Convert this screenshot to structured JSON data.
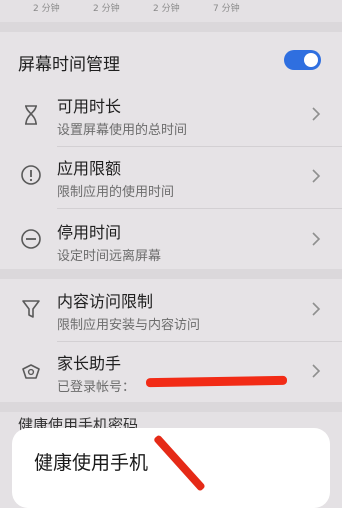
{
  "top_strip": {
    "labels": [
      "2 分钟",
      "2 分钟",
      "2 分钟",
      "7 分钟"
    ]
  },
  "screen_time": {
    "title": "屏幕时间管理",
    "toggle_on": true,
    "items": [
      {
        "icon": "hourglass-icon",
        "title": "可用时长",
        "subtitle": "设置屏幕使用的总时间"
      },
      {
        "icon": "exclamation-circle-icon",
        "title": "应用限额",
        "subtitle": "限制应用的使用时间"
      },
      {
        "icon": "minus-circle-icon",
        "title": "停用时间",
        "subtitle": "设定时间远离屏幕"
      }
    ]
  },
  "restrictions": {
    "items": [
      {
        "icon": "filter-icon",
        "title": "内容访问限制",
        "subtitle": "限制应用安装与内容访问"
      },
      {
        "icon": "parent-assistant-icon",
        "title": "家长助手",
        "subtitle": "已登录帐号："
      }
    ]
  },
  "below_partial_text": "健康使用手机密码",
  "sheet": {
    "title": "健康使用手机"
  },
  "colors": {
    "accent": "#2f6fe0",
    "annotation_red": "#f22b16"
  }
}
